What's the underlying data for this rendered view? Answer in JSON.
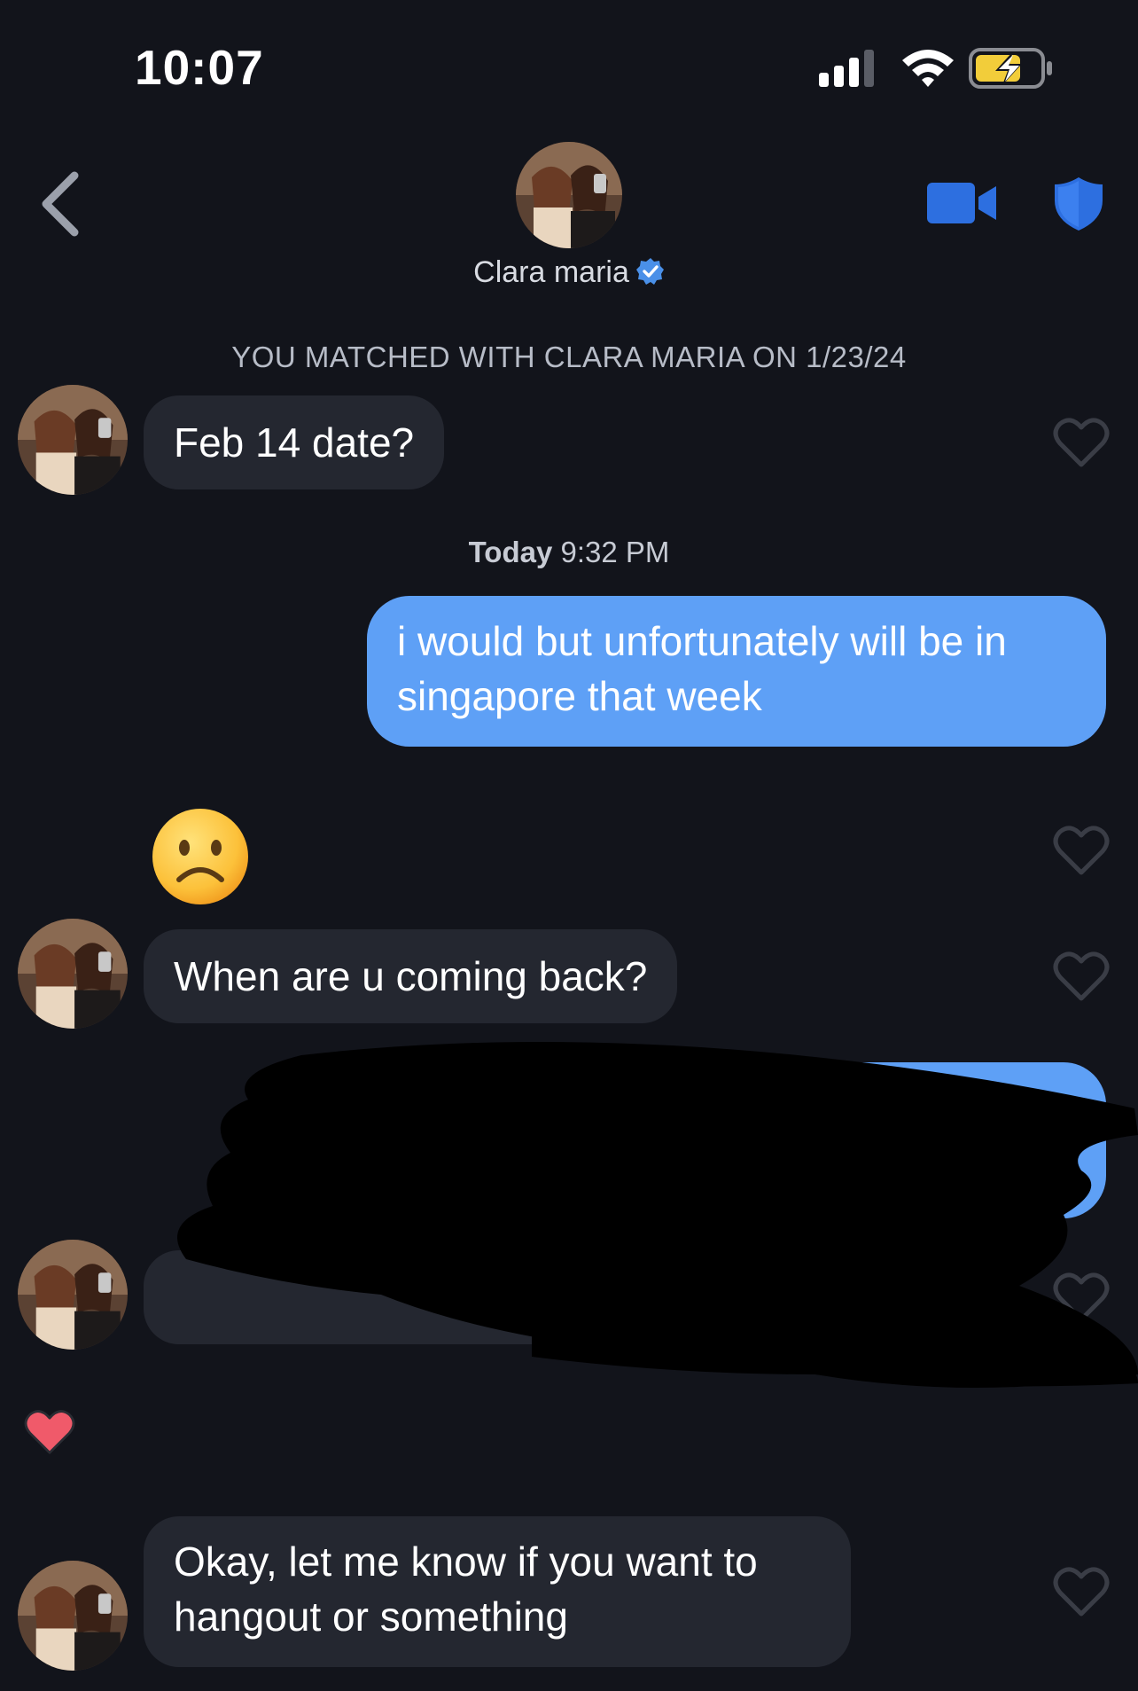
{
  "status_bar": {
    "time": "10:07"
  },
  "header": {
    "contact_name": "Clara maria",
    "verified": true
  },
  "match_banner": "YOU MATCHED WITH CLARA MARIA ON 1/23/24",
  "timestamp": {
    "day": "Today",
    "time": "9:32 PM"
  },
  "messages": [
    {
      "from": "them",
      "text": "Feb 14 date?"
    },
    {
      "from": "me",
      "text": "i would but unfortunately will be in singapore that week"
    },
    {
      "from": "them",
      "emoji": "☹️"
    },
    {
      "from": "them",
      "text": "When are u coming back?"
    },
    {
      "from": "me",
      "text": "",
      "redacted": true
    },
    {
      "from": "them",
      "text": "",
      "redacted": true
    },
    {
      "from": "them",
      "text": "Okay, let me know if you want to hangout or something"
    }
  ],
  "colors": {
    "background": "#12141b",
    "outgoing_bubble": "#5ea0f6",
    "incoming_bubble": "#242730",
    "accent_blue": "#2d6fe0",
    "liked_heart": "#f05a6a"
  }
}
